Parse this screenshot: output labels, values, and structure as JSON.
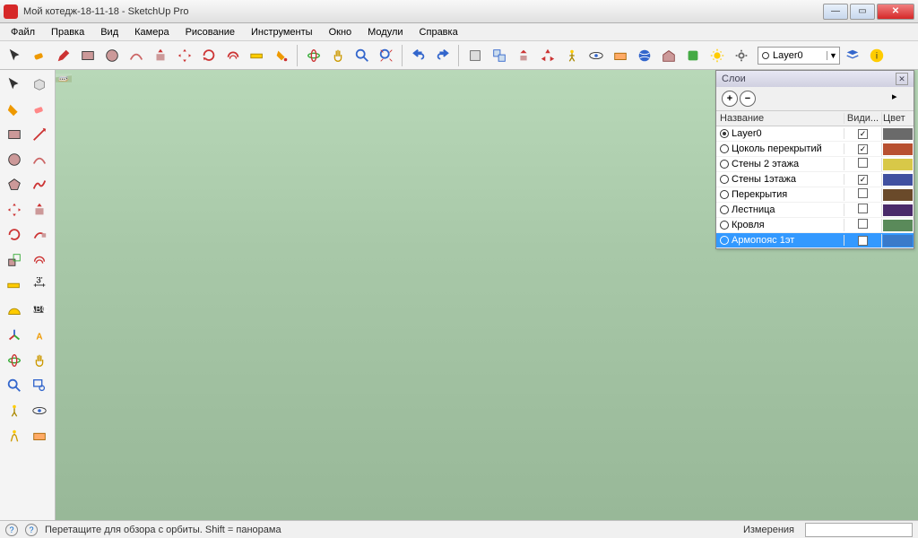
{
  "window": {
    "title": "Мой котедж-18-11-18 - SketchUp Pro"
  },
  "menubar": [
    "Файл",
    "Правка",
    "Вид",
    "Камера",
    "Рисование",
    "Инструменты",
    "Окно",
    "Модули",
    "Справка"
  ],
  "layer_dropdown": {
    "value": "Layer0"
  },
  "layers_panel": {
    "title": "Слои",
    "columns": {
      "name": "Название",
      "visible": "Види...",
      "color": "Цвет"
    },
    "rows": [
      {
        "name": "Layer0",
        "active": true,
        "visible": true,
        "color": "#6a6a6a",
        "selected": false
      },
      {
        "name": "Цоколь перекрытий",
        "active": false,
        "visible": true,
        "color": "#b85030",
        "selected": false
      },
      {
        "name": "Стены 2 этажа",
        "active": false,
        "visible": false,
        "color": "#d8c848",
        "selected": false
      },
      {
        "name": "Стены 1этажа",
        "active": false,
        "visible": true,
        "color": "#4050a0",
        "selected": false
      },
      {
        "name": "Перекрытия",
        "active": false,
        "visible": false,
        "color": "#6a4a2a",
        "selected": false
      },
      {
        "name": "Лестница",
        "active": false,
        "visible": false,
        "color": "#4a2a6a",
        "selected": false
      },
      {
        "name": "Кровля",
        "active": false,
        "visible": false,
        "color": "#5a8a5a",
        "selected": false
      },
      {
        "name": "Армопояс 1эт",
        "active": false,
        "visible": true,
        "color": "#3a7aca",
        "selected": true
      }
    ]
  },
  "status": {
    "hint": "Перетащите для обзора с орбиты. Shift = панорама",
    "measure_label": "Измерения"
  }
}
